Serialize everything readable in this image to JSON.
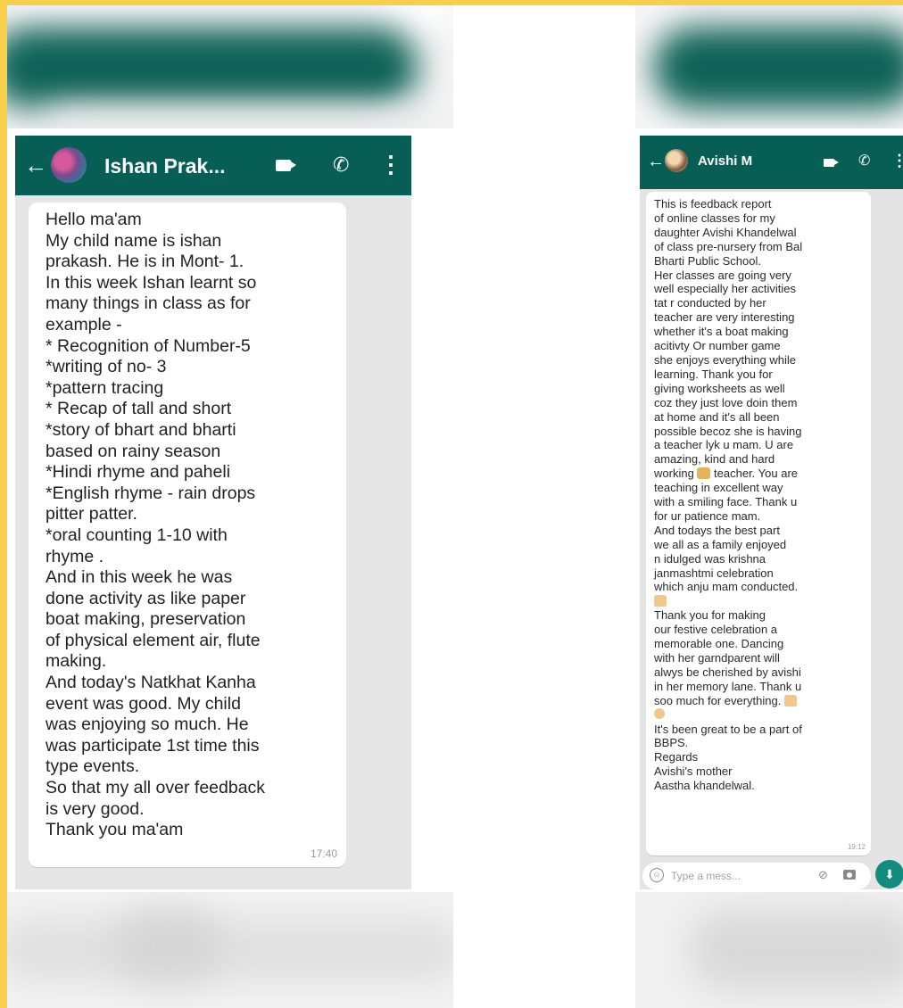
{
  "left_chat": {
    "contact_name": "Ishan Prak...",
    "message_lines": [
      "Hello ma'am",
      "My child name is ishan",
      "prakash.  He is in Mont- 1.",
      "In this week Ishan learnt so",
      "many things in class as for",
      "example -",
      "* Recognition of Number-5",
      "*writing of no- 3",
      "*pattern  tracing",
      "* Recap of tall and short",
      "*story of bhart and bharti",
      "based on rainy season",
      "*Hindi rhyme and paheli",
      "*English rhyme - rain drops",
      "pitter patter.",
      "*oral counting 1-10 with",
      "rhyme .",
      "And in this week he was",
      "done activity as like paper",
      "boat making,  preservation",
      "of physical element air, flute",
      "making.",
      "And today's Natkhat Kanha",
      "event was good.  My child",
      "was enjoying so much.  He",
      "was participate 1st time this",
      "type events.",
      "So that my all over feedback",
      "is very good.",
      "Thank you ma'am"
    ],
    "time": "17:40"
  },
  "right_chat": {
    "contact_name": "Avishi M",
    "message_part1": "This is feedback report\nof online classes for my\ndaughter Avishi Khandelwal\nof class pre-nursery from Bal\nBharti Public School.\nHer classes are going very\nwell especially her activities\ntat r conducted by her\nteacher are very interesting\nwhether it's a boat making\nacitivty Or number game\nshe enjoys everything while\nlearning. Thank you for\ngiving worksheets as well\ncoz they just love doin them\nat home and it's all been\npossible becoz she is having\na teacher lyk u mam. U are\namazing, kind and hard\nworking ",
    "message_part2": " teacher. You are\nteaching in excellent way\nwith a smiling face. Thank u\nfor ur patience mam.\n And todays the best part\nwe all as a family enjoyed\nn idulged was krishna\njanmashtmi celebration\nwhich anju mam conducted.\n",
    "message_part3": "\nThank you for making\nour festive celebration a\nmemorable one. Dancing\nwith her garndparent  will\nalwys be cherished by avishi\nin her memory lane. Thank u\nsoo much for everything. ",
    "message_part4": "\n",
    "message_part5": "\nIt's been great to be a part of\nBBPS.\nRegards\nAvishi's mother\nAastha khandelwal.",
    "time": "19:12",
    "input_placeholder": "Type a mess..."
  },
  "icons": {
    "back": "back-arrow-icon",
    "video": "video-call-icon",
    "phone": "phone-icon",
    "more": "more-vert-icon",
    "emoji": "emoji-icon",
    "attach": "attach-icon",
    "camera": "camera-icon",
    "mic": "mic-icon"
  },
  "colors": {
    "frame": "#f7cf4a",
    "header": "#075e54",
    "chat_bg": "#e6e6e6",
    "mic": "#128c7e"
  }
}
